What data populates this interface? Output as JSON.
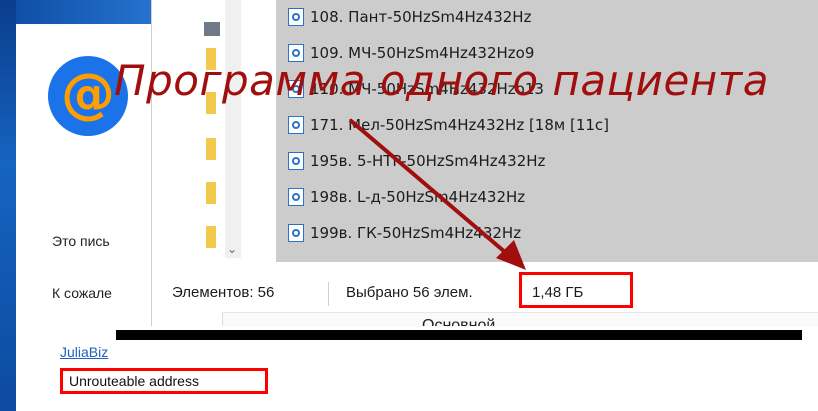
{
  "mail": {
    "line1": "Это пись",
    "line2": "К сожале",
    "link": "JuliaBiz",
    "error_text": "Unrouteable address"
  },
  "explorer": {
    "files": [
      "108. Пант-50HzSm4Hz432Hz",
      "109. МЧ-50HzSm4Hz432Hzo9",
      "110. МЧ-50HzSm4Hz432Hzo13",
      "171. Мел-50HzSm4Hz432Hz [18м [11c]",
      "195в. 5-HTP-50HzSm4Hz432Hz",
      "198в. L-д-50HzSm4Hz432Hz",
      "199в. ГК-50HzSm4Hz432Hz"
    ],
    "status": {
      "count": "Элементов: 56",
      "selected": "Выбрано 56 элем.",
      "size": "1,48 ГБ"
    },
    "bottom_text": "Основной"
  },
  "annotation": {
    "title": "Программа одного пациента",
    "color": "#a10e0e"
  }
}
